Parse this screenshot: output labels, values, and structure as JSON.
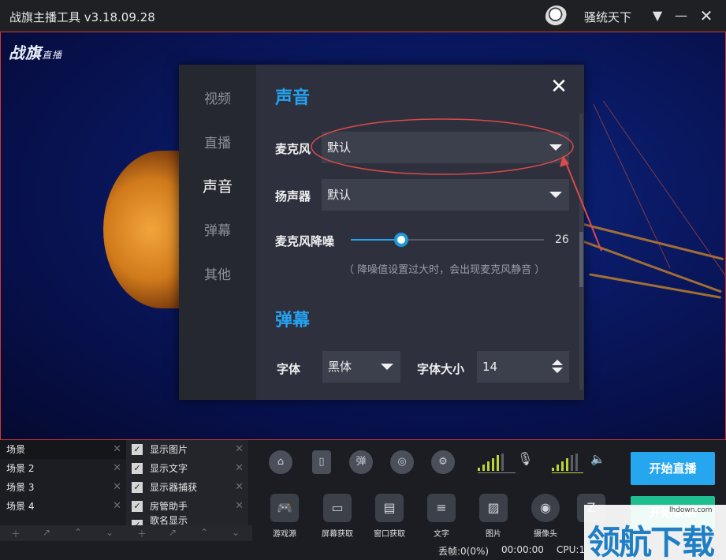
{
  "window": {
    "title": "战旗主播工具 v3.18.09.28",
    "username": "骚统天下"
  },
  "preview": {
    "logo_main": "战旗",
    "logo_sub": "直播"
  },
  "dialog": {
    "nav": [
      "视频",
      "直播",
      "声音",
      "弹幕",
      "其他"
    ],
    "active_nav": "声音",
    "sound": {
      "title": "声音",
      "mic_label": "麦克风",
      "mic_value": "默认",
      "speaker_label": "扬声器",
      "speaker_value": "默认",
      "noise_label": "麦克风降噪",
      "noise_value": "26",
      "noise_level_fraction": 0.26,
      "noise_hint": "（ 降噪值设置过大时，会出现麦克风静音 ）"
    },
    "danmaku": {
      "title": "弹幕",
      "font_label": "字体",
      "font_value": "黑体",
      "size_label": "字体大小",
      "size_value": "14"
    }
  },
  "scenes": [
    "场景",
    "场景 2",
    "场景 3",
    "场景 4"
  ],
  "sources": [
    "显示图片",
    "显示文字",
    "显示器捕获",
    "房管助手",
    "歌名显示"
  ],
  "tools": [
    "游戏源",
    "屏幕获取",
    "窗口获取",
    "文字",
    "图片",
    "摄像头"
  ],
  "buttons": {
    "live": "开始直播",
    "record": "开始录制"
  },
  "status": {
    "dropped": "丢帧:0(0%)",
    "time": "00:00:00",
    "cpu": "CPU:1"
  },
  "watermark": {
    "text": "领航下载",
    "site": "lhdown.com"
  },
  "colors": {
    "accent": "#24a3f2",
    "live": "#27a6f0",
    "record": "#1fbe8f",
    "annotation": "#d94a4a"
  }
}
